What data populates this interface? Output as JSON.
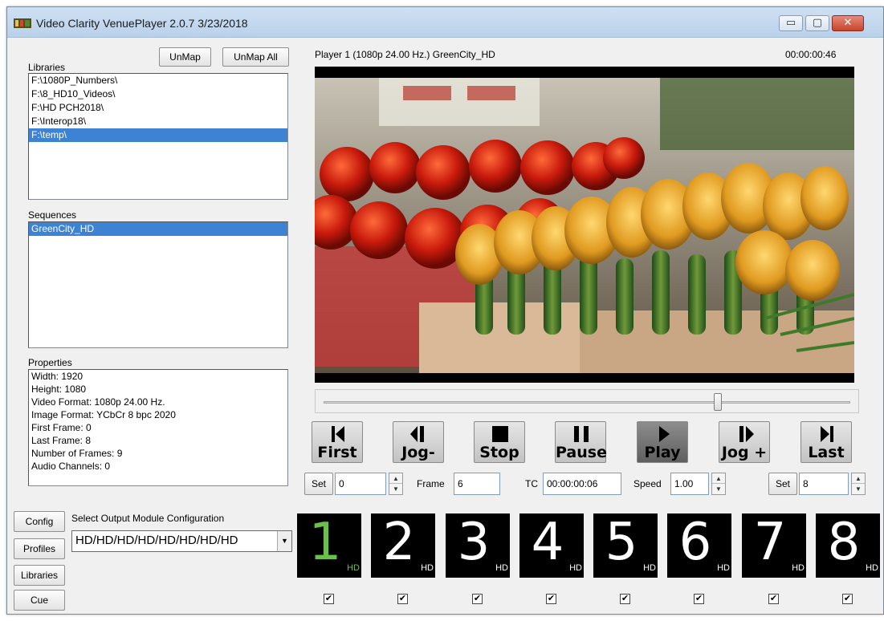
{
  "window": {
    "title": "Video Clarity VenuePlayer  2.0.7  3/23/2018",
    "minimize": "▭",
    "maximize": "▢",
    "close": "✕"
  },
  "libraries": {
    "label": "Libraries",
    "unmap_label": "UnMap",
    "unmap_all_label": "UnMap All",
    "items": [
      "F:\\1080P_Numbers\\",
      "F:\\8_HD10_Videos\\",
      "F:\\HD PCH2018\\",
      "F:\\Interop18\\",
      "F:\\temp\\"
    ],
    "selected_index": 4
  },
  "sequences": {
    "label": "Sequences",
    "items": [
      "GreenCity_HD"
    ],
    "selected_index": 0
  },
  "properties": {
    "label": "Properties",
    "items": [
      "Width: 1920",
      "Height: 1080",
      "Video Format: 1080p 24.00 Hz.",
      "Image Format: YCbCr 8 bpc 2020",
      "First Frame: 0",
      "Last Frame: 8",
      "Number of Frames: 9",
      "Audio Channels: 0"
    ]
  },
  "player": {
    "header": "Player 1  (1080p 24.00 Hz.)  GreenCity_HD",
    "timecode": "00:00:00:46",
    "position_fraction": 0.75
  },
  "transport": [
    {
      "name": "first",
      "label": "First",
      "icon": "skip-to-start-icon",
      "active": false
    },
    {
      "name": "jog-minus",
      "label": "Jog-",
      "icon": "step-back-icon",
      "active": false
    },
    {
      "name": "stop",
      "label": "Stop",
      "icon": "stop-icon",
      "active": false
    },
    {
      "name": "pause",
      "label": "Pause",
      "icon": "pause-icon",
      "active": false
    },
    {
      "name": "play",
      "label": "Play",
      "icon": "play-icon",
      "active": true
    },
    {
      "name": "jog-plus",
      "label": "Jog +",
      "icon": "step-forward-icon",
      "active": false
    },
    {
      "name": "last",
      "label": "Last",
      "icon": "skip-to-end-icon",
      "active": false
    }
  ],
  "controls": {
    "set_label": "Set",
    "first_value": "0",
    "frame_label": "Frame",
    "frame_value": "6",
    "tc_label": "TC",
    "tc_value": "00:00:00:06",
    "speed_label": "Speed",
    "speed_value": "1.00",
    "set_last_label": "Set",
    "last_value": "8"
  },
  "side_buttons": [
    "Config",
    "Profiles",
    "Libraries",
    "Cue"
  ],
  "output": {
    "label": "Select Output Module Configuration",
    "value": "HD/HD/HD/HD/HD/HD/HD/HD",
    "modules": [
      {
        "number": "1",
        "tag": "HD",
        "active": true,
        "checked": true
      },
      {
        "number": "2",
        "tag": "HD",
        "active": false,
        "checked": true
      },
      {
        "number": "3",
        "tag": "HD",
        "active": false,
        "checked": true
      },
      {
        "number": "4",
        "tag": "HD",
        "active": false,
        "checked": true
      },
      {
        "number": "5",
        "tag": "HD",
        "active": false,
        "checked": true
      },
      {
        "number": "6",
        "tag": "HD",
        "active": false,
        "checked": true
      },
      {
        "number": "7",
        "tag": "HD",
        "active": false,
        "checked": true
      },
      {
        "number": "8",
        "tag": "HD",
        "active": false,
        "checked": true
      }
    ]
  },
  "colors": {
    "selection": "#3e83d3",
    "active_module": "#6dbf4b"
  }
}
